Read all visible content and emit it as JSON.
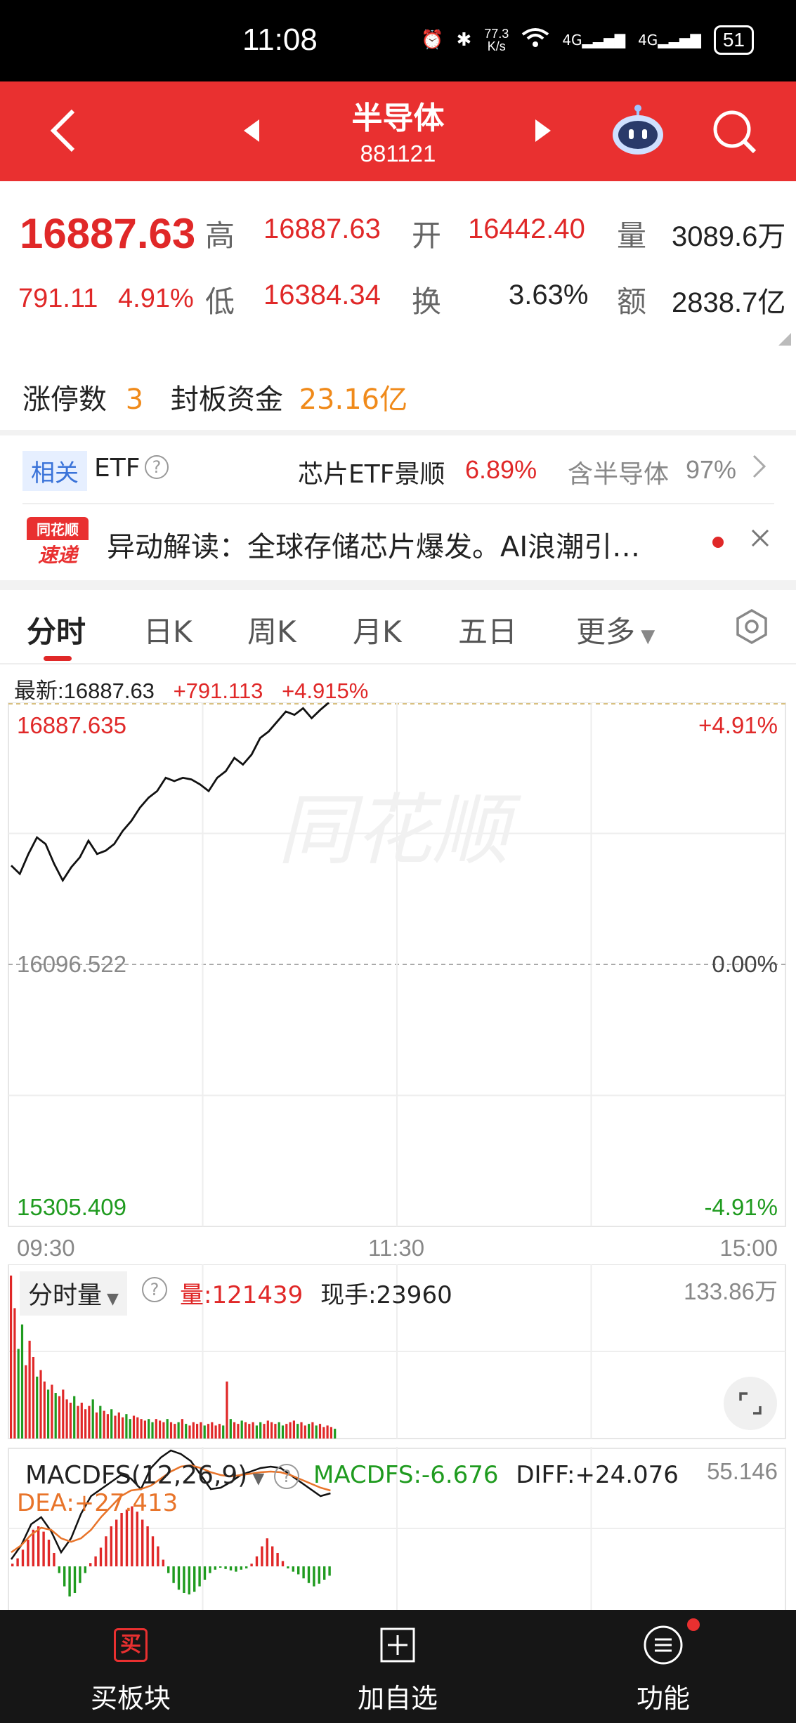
{
  "status": {
    "time": "11:08",
    "speed": "77.3",
    "speed_unit": "K/s",
    "net1": "4G",
    "net2": "4G",
    "battery": "51"
  },
  "header": {
    "title": "半导体",
    "code": "881121"
  },
  "quote": {
    "price": "16887.63",
    "change": "791.11",
    "change_pct": "4.91%",
    "high_label": "高",
    "high": "16887.63",
    "open_label": "开",
    "open": "16442.40",
    "volume_label": "量",
    "volume": "3089.6万",
    "low_label": "低",
    "low": "16384.34",
    "turnover_label": "换",
    "turnover": "3.63%",
    "amount_label": "额",
    "amount": "2838.7亿"
  },
  "limit": {
    "count_label": "涨停数",
    "count": "3",
    "fund_label": "封板资金",
    "fund": "23.16亿"
  },
  "etf": {
    "tag": "相关",
    "label": "ETF",
    "name": "芯片ETF景顺",
    "change": "6.89%",
    "contains_label": "含半导体",
    "contains": "97%"
  },
  "news": {
    "logo_line1": "同花顺",
    "logo_line2": "速递",
    "text": "异动解读：全球存储芯片爆发。AI浪潮引…"
  },
  "tabs": [
    "分时",
    "日K",
    "周K",
    "月K",
    "五日",
    "更多"
  ],
  "chart_header": {
    "latest_label": "最新:",
    "latest": "16887.63",
    "change": "+791.113",
    "change_pct": "+4.915%"
  },
  "chart_data": {
    "type": "line",
    "y_max_label": "16887.635",
    "y_mid_label": "16096.522",
    "y_min_label": "15305.409",
    "pct_max_label": "+4.91%",
    "pct_mid_label": "0.00%",
    "pct_min_label": "-4.91%",
    "x_labels": [
      "09:30",
      "11:30",
      "15:00"
    ],
    "ylim": [
      15305.409,
      16887.635
    ],
    "watermark": "同花顺",
    "values": [
      16395,
      16370,
      16430,
      16480,
      16460,
      16400,
      16350,
      16390,
      16420,
      16470,
      16430,
      16440,
      16460,
      16500,
      16530,
      16570,
      16600,
      16620,
      16660,
      16650,
      16660,
      16655,
      16640,
      16620,
      16660,
      16680,
      16720,
      16700,
      16730,
      16780,
      16800,
      16830,
      16860,
      16850,
      16870,
      16840,
      16865,
      16887
    ]
  },
  "volume_panel": {
    "label": "分时量",
    "vol_label": "量:",
    "vol": "121439",
    "hand_label": "现手:",
    "hand": "23960",
    "max": "133.86万"
  },
  "macd_panel": {
    "label": "MACDFS(12,26,9)",
    "macdfs_label": "MACDFS:",
    "macdfs": "-6.676",
    "diff_label": "DIFF:",
    "diff": "+24.076",
    "dea_label": "DEA:",
    "dea": "+27.413",
    "max": "55.146"
  },
  "nav": {
    "buy": "买板块",
    "buy_icon_text": "买",
    "add": "加自选",
    "func": "功能"
  },
  "colors": {
    "up": "#e02828",
    "down": "#1f9b1f",
    "header": "#e93030"
  }
}
